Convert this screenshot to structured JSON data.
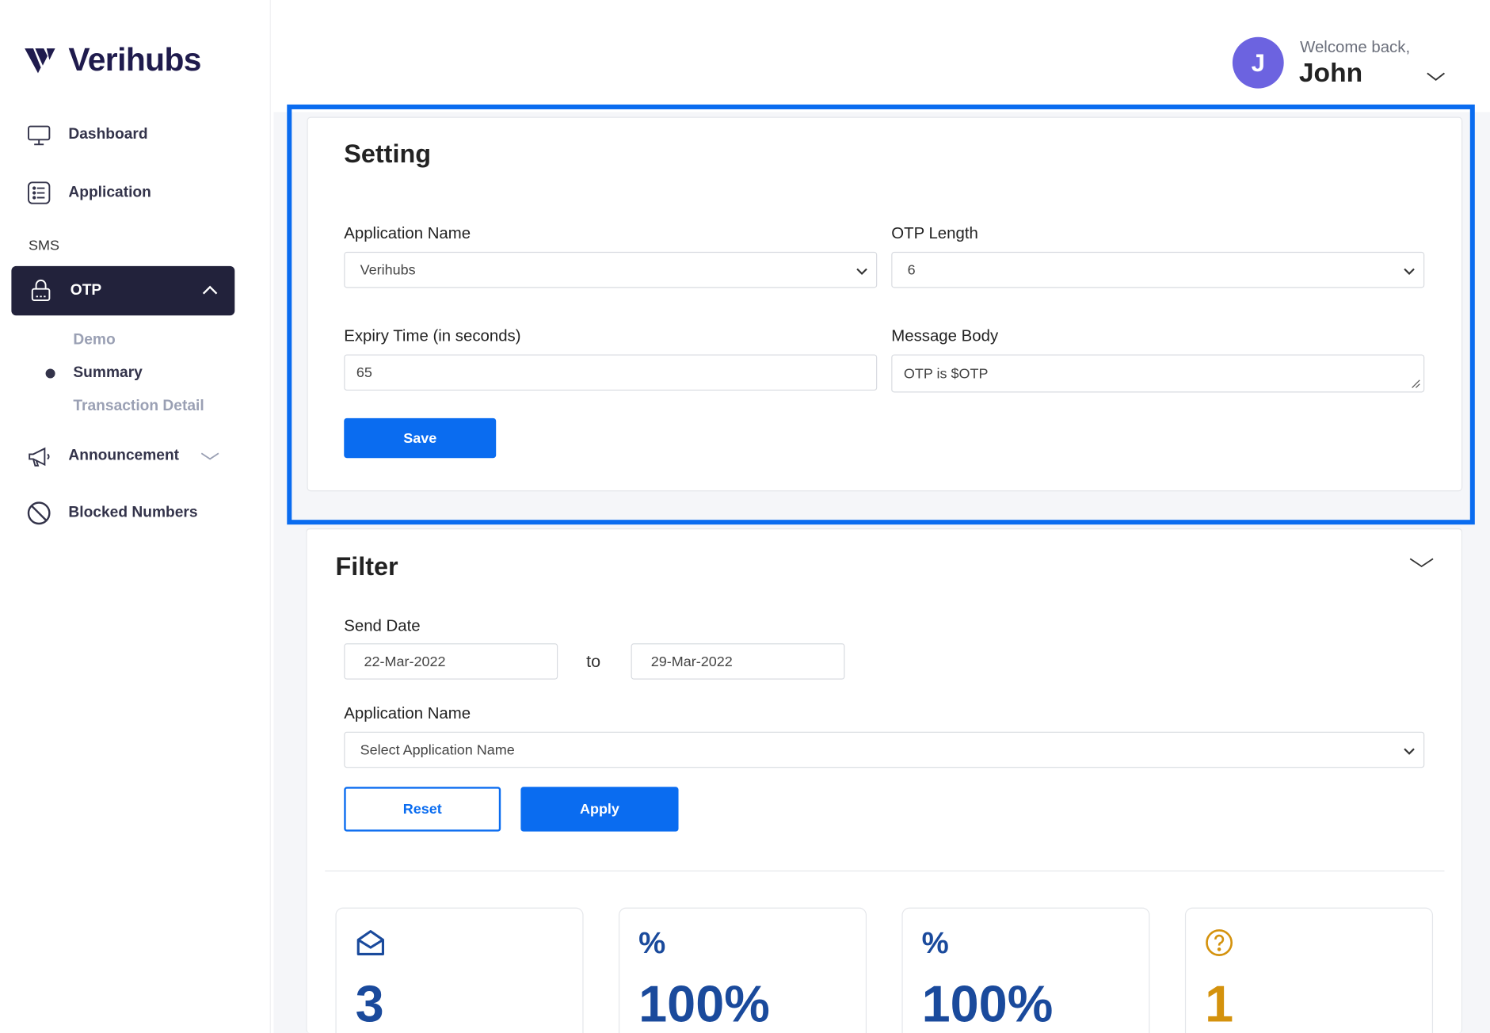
{
  "brand": {
    "name": "Verihubs",
    "color": "#1f1b4d"
  },
  "sidebar": {
    "items": [
      {
        "label": "Dashboard",
        "icon": "monitor-icon"
      },
      {
        "label": "Application",
        "icon": "list-icon"
      }
    ],
    "section_label": "SMS",
    "otp": {
      "label": "OTP",
      "icon": "lock-icon",
      "sub_items": [
        "Demo",
        "Summary",
        "Transaction Detail"
      ],
      "active_sub": "Summary"
    },
    "announcement": {
      "label": "Announcement",
      "icon": "megaphone-icon"
    },
    "blocked": {
      "label": "Blocked Numbers",
      "icon": "block-icon"
    },
    "active_bg": "#22223b"
  },
  "header": {
    "avatar_initial": "J",
    "avatar_color": "#6c63e0",
    "welcome": "Welcome back,",
    "username": "John"
  },
  "setting": {
    "title": "Setting",
    "app_name_label": "Application Name",
    "app_name_value": "Verihubs",
    "otp_length_label": "OTP Length",
    "otp_length_value": "6",
    "expiry_label": "Expiry Time (in seconds)",
    "expiry_value": "65",
    "message_label": "Message Body",
    "message_value": "OTP is $OTP",
    "save_label": "Save"
  },
  "filter": {
    "title": "Filter",
    "send_date_label": "Send Date",
    "date_from": "22-Mar-2022",
    "to_label": "to",
    "date_to": "29-Mar-2022",
    "app_name_label": "Application Name",
    "app_name_placeholder": "Select Application Name",
    "reset_label": "Reset",
    "apply_label": "Apply"
  },
  "stats": [
    {
      "icon": "envelope-open-icon",
      "value": "3"
    },
    {
      "icon": "percent-icon",
      "icon_text": "%",
      "value": "100%"
    },
    {
      "icon": "percent-icon",
      "icon_text": "%",
      "value": "100%"
    },
    {
      "icon": "question-circle-icon",
      "value": "1"
    }
  ],
  "colors": {
    "accent": "#0a6cf0",
    "stat_blue": "#1a4a9c",
    "stat_orange": "#d4920d"
  }
}
